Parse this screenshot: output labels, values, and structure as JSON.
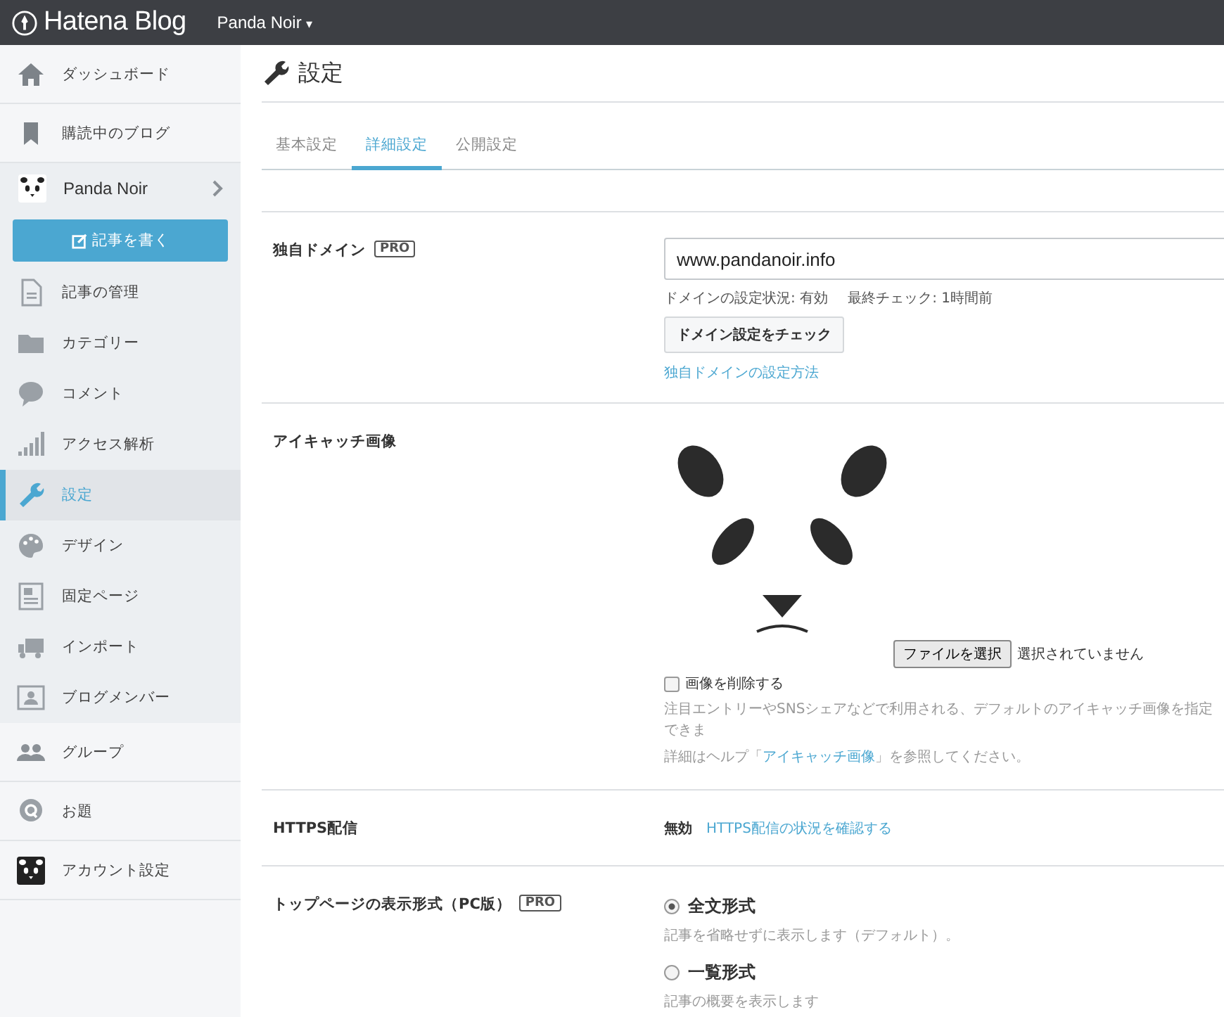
{
  "header": {
    "logo": "Hatena Blog",
    "blog_menu": "Panda Noir",
    "caret": "▾"
  },
  "sidebar": {
    "top_items": [
      {
        "label": "ダッシュボード",
        "selected": false
      },
      {
        "label": "購読中のブログ",
        "selected": false
      }
    ],
    "blog": {
      "name": "Panda Noir",
      "write_button": "記事を書く"
    },
    "blog_items": [
      {
        "label": "記事の管理",
        "selected": false
      },
      {
        "label": "カテゴリー",
        "selected": false
      },
      {
        "label": "コメント",
        "selected": false
      },
      {
        "label": "アクセス解析",
        "selected": false
      },
      {
        "label": "設定",
        "selected": true
      },
      {
        "label": "デザイン",
        "selected": false
      },
      {
        "label": "固定ページ",
        "selected": false
      },
      {
        "label": "インポート",
        "selected": false
      },
      {
        "label": "ブログメンバー",
        "selected": false
      }
    ],
    "bottom_items": [
      {
        "label": "グループ",
        "selected": false
      },
      {
        "label": "お題",
        "selected": false
      },
      {
        "label": "アカウント設定",
        "selected": false
      }
    ]
  },
  "page": {
    "title": "設定",
    "tabs": [
      {
        "label": "基本設定",
        "selected": false
      },
      {
        "label": "詳細設定",
        "selected": true
      },
      {
        "label": "公開設定",
        "selected": false
      }
    ]
  },
  "settings": {
    "domain": {
      "label": "独自ドメイン",
      "badge": "PRO",
      "value": "www.pandanoir.info",
      "status": "ドメインの設定状況: 有効",
      "last_check": "最終チェック: 1時間前",
      "check_button": "ドメイン設定をチェック",
      "help_link": "独自ドメインの設定方法"
    },
    "eyecatch": {
      "label": "アイキャッチ画像",
      "file_button": "ファイルを選択",
      "file_status": "選択されていません",
      "delete_checkbox": {
        "label": "画像を削除する",
        "checked": false
      },
      "help_text": "注目エントリーやSNSシェアなどで利用される、デフォルトのアイキャッチ画像を指定できま",
      "note_before": "詳細はヘルプ「",
      "note_link": "アイキャッチ画像",
      "note_after": "」を参照してください。"
    },
    "https": {
      "label": "HTTPS配信",
      "status": "無効",
      "link": "HTTPS配信の状況を確認する"
    },
    "top_page": {
      "label": "トップページの表示形式（PC版）",
      "badge": "PRO",
      "options": [
        {
          "label": "全文形式",
          "description": "記事を省略せずに表示します（デフォルト）。",
          "selected": true
        },
        {
          "label": "一覧形式",
          "description": "記事の概要を表示します",
          "selected": false
        }
      ]
    }
  }
}
